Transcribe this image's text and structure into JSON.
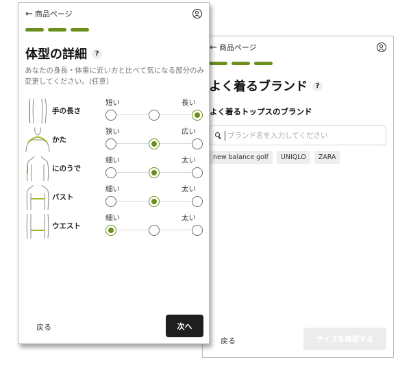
{
  "brand_screen": {
    "back_link": "商品ページ",
    "title": "よく着るブランド",
    "help": "?",
    "subtitle": "よく着るトップスのブランド",
    "search": {
      "value": "",
      "placeholder": "ブランド名を入力してください"
    },
    "chips": [
      "new balance golf",
      "UNIQLO",
      "ZARA"
    ],
    "back_button": "戻る",
    "confirm_button": "サイズを確認する"
  },
  "body_screen": {
    "back_link": "商品ページ",
    "title": "体型の詳細",
    "help": "?",
    "description": "あなたの身長・体重に近い方と比べて気になる部分のみ変更してください。(任意)",
    "rows": [
      {
        "label": "手の長さ",
        "min": "短い",
        "max": "長い",
        "selected": 2
      },
      {
        "label": "かた",
        "min": "狭い",
        "max": "広い",
        "selected": 1
      },
      {
        "label": "にのうで",
        "min": "細い",
        "max": "太い",
        "selected": 1
      },
      {
        "label": "バスト",
        "min": "細い",
        "max": "太い",
        "selected": 1
      },
      {
        "label": "ウエスト",
        "min": "細い",
        "max": "太い",
        "selected": 0
      }
    ],
    "back_button": "戻る",
    "next_button": "次へ"
  },
  "colors": {
    "accent": "#6b8f1c",
    "dark_button": "#1e1e1e",
    "disabled_button": "#ececec"
  }
}
